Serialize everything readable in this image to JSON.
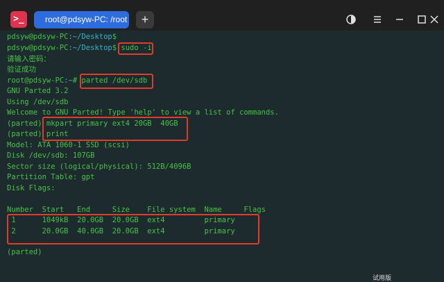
{
  "window": {
    "tab_title": "root@pdsyw-PC: /root",
    "new_tab_label": "+",
    "app_icon_glyph": ">_"
  },
  "terminal": {
    "lines": [
      {
        "prompt": "pdsyw@pdsyw-PC",
        "path": ":~/Desktop",
        "suffix": "$",
        "command": ""
      },
      {
        "prompt": "pdsyw@pdsyw-PC",
        "path": ":~/Desktop",
        "suffix": "$",
        "command": " sudo -i"
      },
      {
        "text": "请输入密码："
      },
      {
        "text": "验证成功"
      },
      {
        "prompt": "root@pdsyw-PC",
        "path": ":~",
        "suffix": "#",
        "command": " parted /dev/sdb"
      },
      {
        "text": "GNU Parted 3.2"
      },
      {
        "text": "Using /dev/sdb"
      },
      {
        "text": "Welcome to GNU Parted! Type 'help' to view a list of commands."
      },
      {
        "text": "(parted) mkpart primary ext4 20GB  40GB"
      },
      {
        "text": "(parted) print"
      },
      {
        "text": "Model: ATA 1060-1 SSD (scsi)"
      },
      {
        "text": "Disk /dev/sdb: 107GB"
      },
      {
        "text": "Sector size (logical/physical): 512B/4096B"
      },
      {
        "text": "Partition Table: gpt"
      },
      {
        "text": "Disk Flags:"
      },
      {
        "text": ""
      },
      {
        "text": "Number  Start   End     Size    File system  Name     Flags"
      },
      {
        "text": " 1      1049kB  20.0GB  20.0GB  ext4         primary"
      },
      {
        "text": " 2      20.0GB  40.0GB  20.0GB  ext4         primary"
      },
      {
        "text": ""
      },
      {
        "text": "(parted)"
      }
    ]
  },
  "colors": {
    "terminal_bg": "#1d2a2e",
    "text_green": "#47c347",
    "path_cyan": "#2fb6cc",
    "highlight_box": "#e03c2a",
    "tab_blue": "#2d6cdf"
  },
  "watermark": "试用版"
}
